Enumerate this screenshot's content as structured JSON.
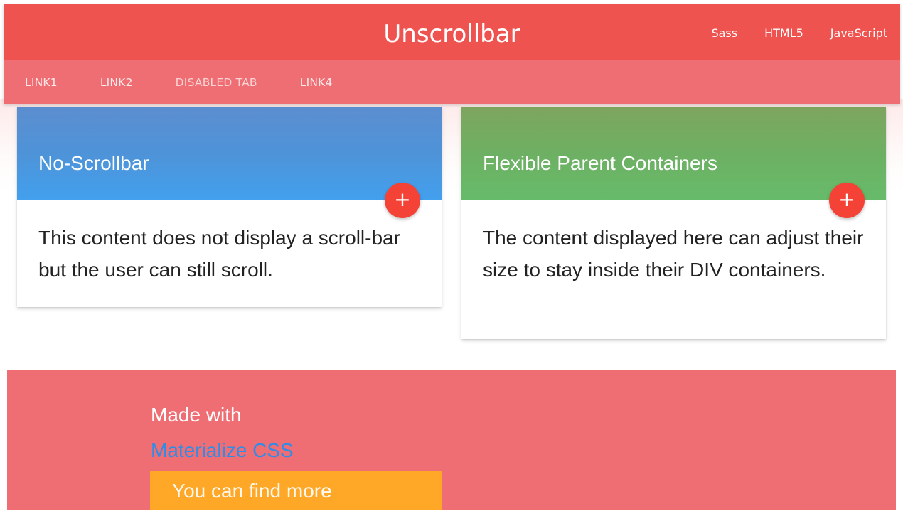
{
  "navbar": {
    "brand": "Unscrollbar",
    "links": [
      "Sass",
      "HTML5",
      "JavaScript"
    ],
    "color": "#ef5350"
  },
  "tabs": {
    "items": [
      "LINK1",
      "LINK2",
      "DISABLED TAB",
      "LINK4"
    ],
    "color": "#ee6e73"
  },
  "cards": [
    {
      "title": "No-Scrollbar",
      "fab_label": "+",
      "body": "This content does not display a scroll-bar but the user can still scroll.",
      "header_color": "#42a0ee"
    },
    {
      "title": "Flexible Parent Containers",
      "fab_label": "+",
      "body": "The content displayed here can adjust their size to stay inside their DIV containers.",
      "header_color": "#66bb6a"
    }
  ],
  "footer": {
    "made_with": "Made with",
    "materialize_link": "Materialize CSS",
    "find_more": "You can find more",
    "background": "#ee6e73",
    "link_color": "#2f8ce8",
    "find_more_color": "#ffa726"
  },
  "icons": {
    "fab_icon": "plus-icon"
  }
}
